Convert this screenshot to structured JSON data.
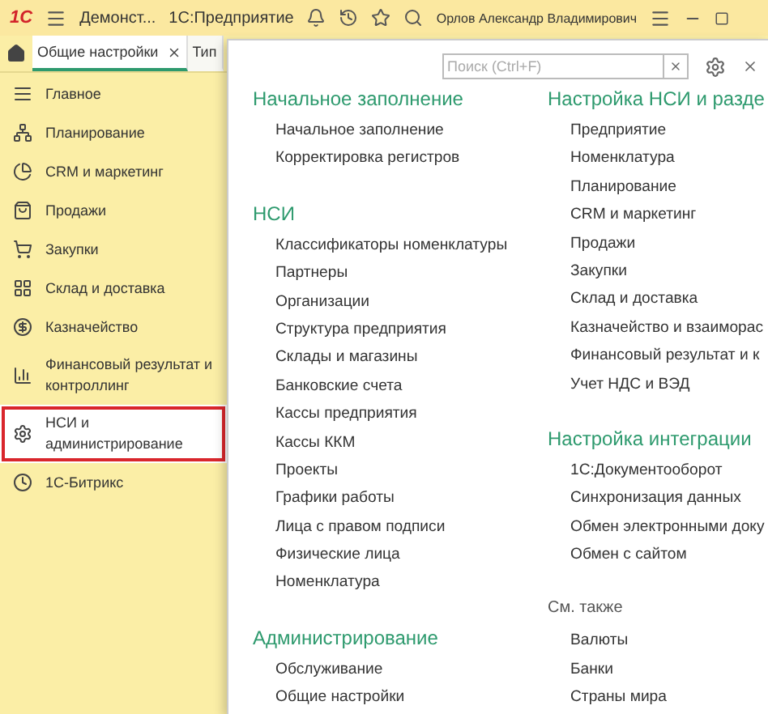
{
  "title_bar": {
    "logo": "1С",
    "app_title": "Демонст...",
    "app_name": "1С:Предприятие",
    "user": "Орлов Александр Владимирович"
  },
  "tabs": [
    {
      "label": "Общие настройки",
      "selected": true,
      "closable": true
    },
    {
      "label": "Тип",
      "selected": false,
      "closable": false
    }
  ],
  "sidebar": {
    "items": [
      {
        "label": "Главное",
        "selected": false
      },
      {
        "label": "Планирование",
        "selected": false
      },
      {
        "label": "CRM и маркетинг",
        "selected": false
      },
      {
        "label": "Продажи",
        "selected": false
      },
      {
        "label": "Закупки",
        "selected": false
      },
      {
        "label": "Склад и доставка",
        "selected": false
      },
      {
        "label": "Казначейство",
        "selected": false
      },
      {
        "label": "Финансовый результат и контроллинг",
        "selected": false
      },
      {
        "label": "НСИ и администрирование",
        "selected": true
      },
      {
        "label": "1С-Битрикс",
        "selected": false
      }
    ]
  },
  "panel": {
    "search": {
      "placeholder": "Поиск (Ctrl+F)"
    },
    "columns": [
      {
        "sections": [
          {
            "kind": "group",
            "title": "Начальное заполнение",
            "items": [
              "Начальное заполнение",
              "Корректировка регистров"
            ]
          },
          {
            "kind": "group",
            "title": "НСИ",
            "items": [
              "Классификаторы номенклатуры",
              "Партнеры",
              "Организации",
              "Структура предприятия",
              "Склады и магазины",
              "Банковские счета",
              "Кассы предприятия",
              "Кассы ККМ",
              "Проекты",
              "Графики работы",
              "Лица с правом подписи",
              "Физические лица",
              "Номенклатура"
            ]
          },
          {
            "kind": "group",
            "title": "Администрирование",
            "items": [
              "Обслуживание",
              "Общие настройки"
            ]
          }
        ]
      },
      {
        "sections": [
          {
            "kind": "group",
            "title": "Настройка НСИ и разде",
            "items": [
              "Предприятие",
              "Номенклатура",
              "Планирование",
              "CRM и маркетинг",
              "Продажи",
              "Закупки",
              "Склад и доставка",
              "Казначейство и взаиморас",
              "Финансовый результат и к",
              "Учет НДС и ВЭД"
            ]
          },
          {
            "kind": "group",
            "title": "Настройка интеграции",
            "items": [
              "1С:Документооборот",
              "Синхронизация данных",
              "Обмен электронными доку",
              "Обмен с сайтом"
            ]
          },
          {
            "kind": "see_also",
            "title": "См. также",
            "items": [
              "Валюты",
              "Банки",
              "Страны мира"
            ]
          }
        ]
      }
    ]
  }
}
